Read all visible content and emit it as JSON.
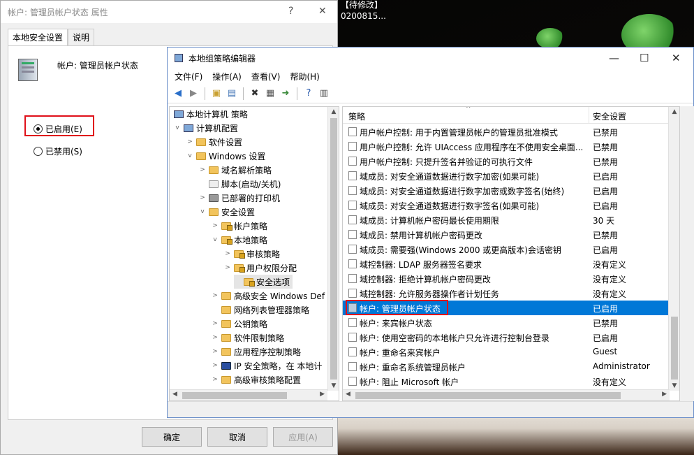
{
  "background": {
    "line1": "【待修改】",
    "line2": "0200815..."
  },
  "properties_dialog": {
    "title": "帐户: 管理员帐户状态 属性",
    "help_glyph": "?",
    "close_glyph": "✕",
    "tabs": [
      "本地安全设置",
      "说明"
    ],
    "policy_name": "帐户: 管理员帐户状态",
    "radio_enabled": "已启用(E)",
    "radio_disabled": "已禁用(S)",
    "buttons": {
      "ok": "确定",
      "cancel": "取消",
      "apply": "应用(A)"
    }
  },
  "gp_editor": {
    "title": "本地组策略编辑器",
    "controls": {
      "minimize": "—",
      "maximize": "☐",
      "close": "✕"
    },
    "menu": [
      "文件(F)",
      "操作(A)",
      "查看(V)",
      "帮助(H)"
    ],
    "tree": [
      {
        "label": "本地计算机 策略",
        "exp": ""
      },
      {
        "label": "计算机配置",
        "exp": "v"
      },
      {
        "label": "软件设置",
        "exp": ">"
      },
      {
        "label": "Windows 设置",
        "exp": "v"
      },
      {
        "label": "域名解析策略",
        "exp": ">"
      },
      {
        "label": "脚本(启动/关机)",
        "exp": ""
      },
      {
        "label": "已部署的打印机",
        "exp": ">"
      },
      {
        "label": "安全设置",
        "exp": "v"
      },
      {
        "label": "帐户策略",
        "exp": ">"
      },
      {
        "label": "本地策略",
        "exp": "v"
      },
      {
        "label": "审核策略",
        "exp": ">"
      },
      {
        "label": "用户权限分配",
        "exp": ">"
      },
      {
        "label": "安全选项",
        "exp": ""
      },
      {
        "label": "高级安全 Windows Def",
        "exp": ">"
      },
      {
        "label": "网络列表管理器策略",
        "exp": ""
      },
      {
        "label": "公钥策略",
        "exp": ">"
      },
      {
        "label": "软件限制策略",
        "exp": ">"
      },
      {
        "label": "应用程序控制策略",
        "exp": ">"
      },
      {
        "label": "IP 安全策略，在 本地计",
        "exp": ">"
      },
      {
        "label": "高级审核策略配置",
        "exp": ">"
      }
    ],
    "list_headers": {
      "policy": "策略",
      "setting": "安全设置"
    },
    "policies": [
      {
        "name": "用户帐户控制: 用于内置管理员帐户的管理员批准模式",
        "setting": "已禁用"
      },
      {
        "name": "用户帐户控制: 允许 UIAccess 应用程序在不使用安全桌面...",
        "setting": "已禁用"
      },
      {
        "name": "用户帐户控制: 只提升签名并验证的可执行文件",
        "setting": "已禁用"
      },
      {
        "name": "域成员: 对安全通道数据进行数字加密(如果可能)",
        "setting": "已启用"
      },
      {
        "name": "域成员: 对安全通道数据进行数字加密或数字签名(始终)",
        "setting": "已启用"
      },
      {
        "name": "域成员: 对安全通道数据进行数字签名(如果可能)",
        "setting": "已启用"
      },
      {
        "name": "域成员: 计算机帐户密码最长使用期限",
        "setting": "30 天"
      },
      {
        "name": "域成员: 禁用计算机帐户密码更改",
        "setting": "已禁用"
      },
      {
        "name": "域成员: 需要强(Windows 2000 或更高版本)会话密钥",
        "setting": "已启用"
      },
      {
        "name": "域控制器: LDAP 服务器签名要求",
        "setting": "没有定义"
      },
      {
        "name": "域控制器: 拒绝计算机帐户密码更改",
        "setting": "没有定义"
      },
      {
        "name": "域控制器: 允许服务器操作者计划任务",
        "setting": "没有定义"
      },
      {
        "name": "帐户: 管理员帐户状态",
        "setting": "已启用"
      },
      {
        "name": "帐户: 来宾帐户状态",
        "setting": "已禁用"
      },
      {
        "name": "帐户: 使用空密码的本地帐户只允许进行控制台登录",
        "setting": "已启用"
      },
      {
        "name": "帐户: 重命名来宾帐户",
        "setting": "Guest"
      },
      {
        "name": "帐户: 重命名系统管理员帐户",
        "setting": "Administrator"
      },
      {
        "name": "帐户: 阻止 Microsoft 帐户",
        "setting": "没有定义"
      }
    ],
    "selected_policy_index": 12,
    "selection_color": "#0078d7"
  }
}
